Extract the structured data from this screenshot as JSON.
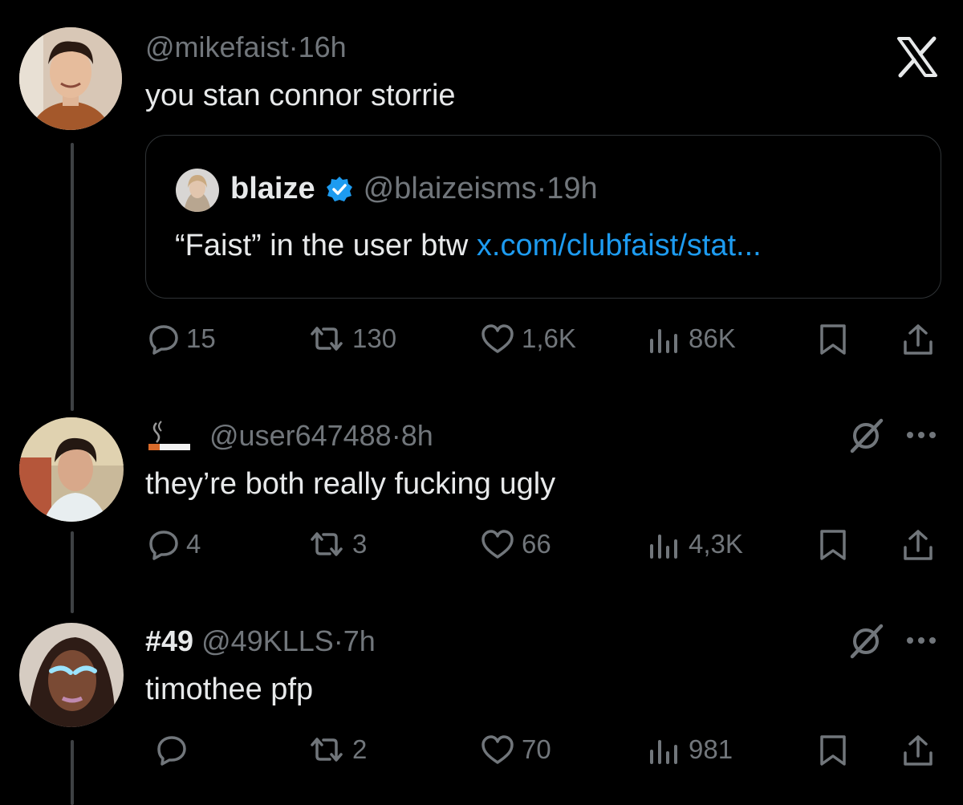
{
  "colors": {
    "background": "#000000",
    "text": "#e7e9ea",
    "muted": "#71767b",
    "link": "#1d9bf0",
    "verified": "#1d9bf0",
    "line": "#3e4144"
  },
  "header": {
    "close_icon": "x-logo-icon"
  },
  "main_post": {
    "handle": "@mikefaist",
    "time": "16h",
    "text": "you stan connor storrie",
    "quote": {
      "name": "blaize",
      "handle": "@blaizeisms",
      "time": "19h",
      "text": "“Faist” in the user btw",
      "link": "x.com/clubfaist/stat..."
    },
    "actions": {
      "replies": "15",
      "reposts": "130",
      "likes": "1,6K",
      "views": "86K"
    }
  },
  "replies": [
    {
      "name_emoji": "🚬",
      "handle": "@user647488",
      "time": "8h",
      "text": "they’re both really fucking ugly",
      "actions": {
        "replies": "4",
        "reposts": "3",
        "likes": "66",
        "views": "4,3K"
      }
    },
    {
      "name": "#49",
      "handle": "@49KLLS",
      "time": "7h",
      "text": "timothee pfp",
      "actions": {
        "replies": "",
        "reposts": "2",
        "likes": "70",
        "views": "981"
      }
    }
  ],
  "separator": "·"
}
